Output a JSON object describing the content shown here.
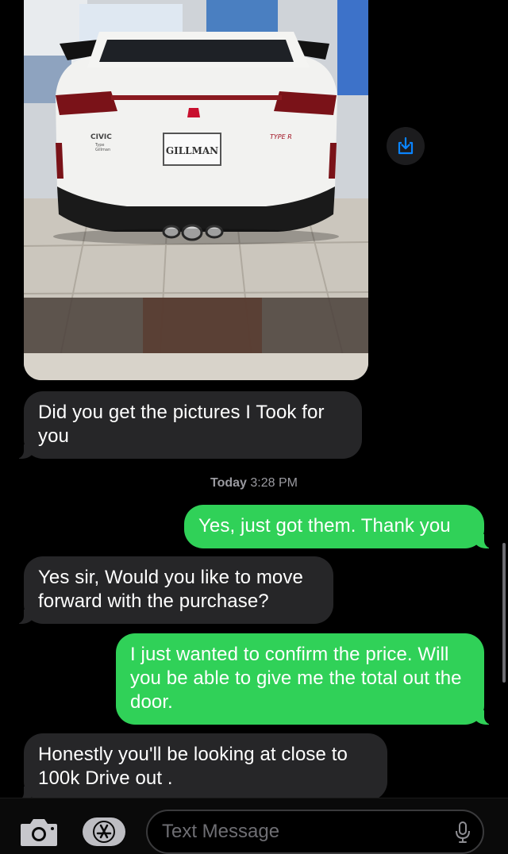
{
  "messages": [
    {
      "direction": "incoming",
      "text": "Did you get the pictures I Took for you"
    },
    {
      "direction": "outgoing",
      "text": "Yes, just got them. Thank you"
    },
    {
      "direction": "incoming",
      "text": "Yes sir, Would you like to move forward with the purchase?"
    },
    {
      "direction": "outgoing",
      "text": "I just wanted to confirm the price. Will you be able to give me the total out the door."
    },
    {
      "direction": "incoming",
      "text": "Honestly you'll be looking at close to 100k Drive out ."
    }
  ],
  "timestamp": {
    "day": "Today",
    "time": "3:28 PM"
  },
  "photo": {
    "badge_left": "CIVIC",
    "badge_left_sub1": "Type",
    "badge_left_sub2": "Gillman",
    "plate_text": "GILLMAN",
    "badge_right": "TYPE R"
  },
  "input": {
    "placeholder": "Text Message"
  },
  "icons": {
    "save": "download-icon",
    "camera": "camera-icon",
    "apps": "app-store-icon",
    "mic": "microphone-icon"
  },
  "colors": {
    "incoming_bubble": "#262628",
    "outgoing_bubble": "#30d158",
    "accent": "#0a84ff"
  }
}
